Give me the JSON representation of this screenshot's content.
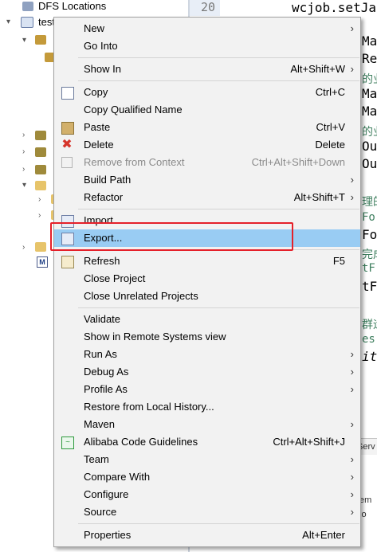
{
  "explorer": {
    "dfs_label": "DFS Locations",
    "project_label": "test"
  },
  "editor": {
    "line_number": "20",
    "lines": [
      "wcjob.setJa",
      "Ma",
      "Re",
      "的业",
      "Ma",
      "Ma",
      "的业",
      "Ou",
      "Ou",
      "理的",
      "Fo",
      "Fo",
      "完成",
      "tF",
      "tF",
      "群运",
      "es",
      "it"
    ]
  },
  "bottom_tabs": [
    "Serv",
    "tem",
    "tio"
  ],
  "menu": {
    "new": {
      "label": "New"
    },
    "go_into": {
      "label": "Go Into"
    },
    "show_in": {
      "label": "Show In",
      "shortcut": "Alt+Shift+W"
    },
    "copy": {
      "label": "Copy",
      "shortcut": "Ctrl+C"
    },
    "copy_qualified": {
      "label": "Copy Qualified Name"
    },
    "paste": {
      "label": "Paste",
      "shortcut": "Ctrl+V"
    },
    "delete": {
      "label": "Delete",
      "shortcut": "Delete"
    },
    "remove_context": {
      "label": "Remove from Context",
      "shortcut": "Ctrl+Alt+Shift+Down"
    },
    "build_path": {
      "label": "Build Path"
    },
    "refactor": {
      "label": "Refactor",
      "shortcut": "Alt+Shift+T"
    },
    "import": {
      "label": "Import..."
    },
    "export": {
      "label": "Export..."
    },
    "refresh": {
      "label": "Refresh",
      "shortcut": "F5"
    },
    "close_project": {
      "label": "Close Project"
    },
    "close_unrelated": {
      "label": "Close Unrelated Projects"
    },
    "validate": {
      "label": "Validate"
    },
    "show_remote": {
      "label": "Show in Remote Systems view"
    },
    "run_as": {
      "label": "Run As"
    },
    "debug_as": {
      "label": "Debug As"
    },
    "profile_as": {
      "label": "Profile As"
    },
    "restore_history": {
      "label": "Restore from Local History..."
    },
    "maven": {
      "label": "Maven"
    },
    "alibaba": {
      "label": "Alibaba Code Guidelines",
      "shortcut": "Ctrl+Alt+Shift+J"
    },
    "team": {
      "label": "Team"
    },
    "compare_with": {
      "label": "Compare With"
    },
    "configure": {
      "label": "Configure"
    },
    "source": {
      "label": "Source"
    },
    "properties": {
      "label": "Properties",
      "shortcut": "Alt+Enter"
    }
  },
  "colors": {
    "highlight": "#99ccf3",
    "annotation_box": "#e5202a",
    "menu_bg": "#f2f2f2",
    "comment": "#3f7f5f"
  }
}
